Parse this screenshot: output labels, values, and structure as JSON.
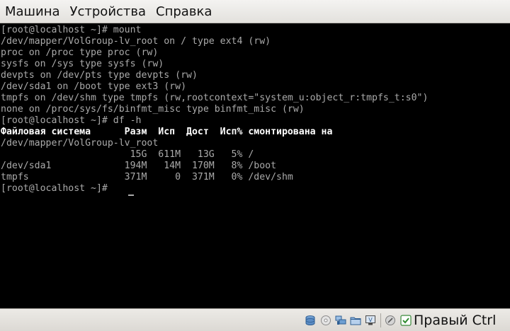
{
  "menubar": {
    "items": [
      "Машина",
      "Устройства",
      "Справка"
    ]
  },
  "terminal": {
    "lines": [
      "[root@localhost ~]# mount",
      "/dev/mapper/VolGroup-lv_root on / type ext4 (rw)",
      "proc on /proc type proc (rw)",
      "sysfs on /sys type sysfs (rw)",
      "devpts on /dev/pts type devpts (rw)",
      "/dev/sda1 on /boot type ext3 (rw)",
      "tmpfs on /dev/shm type tmpfs (rw,rootcontext=\"system_u:object_r:tmpfs_t:s0\")",
      "none on /proc/sys/fs/binfmt_misc type binfmt_misc (rw)",
      "[root@localhost ~]# df -h",
      "Файловая система      Разм  Исп  Дост  Исп% смонтирована на",
      "/dev/mapper/VolGroup-lv_root",
      "                       15G  611M   13G   5% /",
      "/dev/sda1             194M   14M  170M   8% /boot",
      "tmpfs                 371M     0  371M   0% /dev/shm",
      "[root@localhost ~]# "
    ]
  },
  "statusbar": {
    "host_key_label": "Правый Ctrl",
    "icons": [
      "hard-disk-icon",
      "optical-disc-icon",
      "network-icon",
      "shared-folder-icon",
      "display-icon",
      "mouse-integration-icon",
      "host-key-icon"
    ]
  },
  "colors": {
    "terminal_bg": "#000000",
    "terminal_text": "#aaaaaa",
    "terminal_bold": "#ffffff",
    "chrome_bg": "#e8e6e2"
  }
}
